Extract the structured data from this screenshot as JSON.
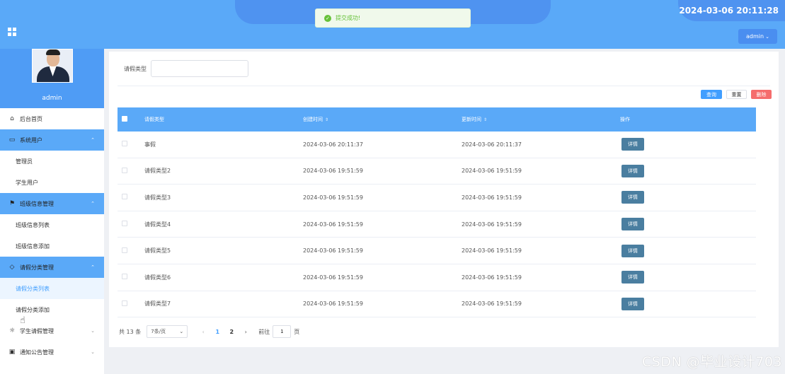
{
  "header": {
    "datetime": "2024-03-06 20:11:28",
    "user_button": "admin"
  },
  "toast": {
    "message": "提交成功!",
    "icon": "check-circle-icon",
    "color": "#67c23a"
  },
  "sidebar": {
    "username": "admin",
    "menu": [
      {
        "label": "后台首页",
        "icon": "home-icon"
      },
      {
        "label": "系统用户",
        "icon": "monitor-icon",
        "expanded": true,
        "children": [
          "管理员",
          "学生用户"
        ]
      },
      {
        "label": "班级信息管理",
        "icon": "bookmark-icon",
        "expanded": true,
        "children": [
          "班级信息列表",
          "班级信息添加"
        ]
      },
      {
        "label": "请假分类管理",
        "icon": "tag-icon",
        "expanded": true,
        "children": [
          "请假分类列表",
          "请假分类添加"
        ]
      },
      {
        "label": "学生请假管理",
        "icon": "sun-icon",
        "expanded": false
      },
      {
        "label": "通知公告管理",
        "icon": "inbox-icon",
        "expanded": false
      }
    ]
  },
  "search": {
    "label": "请假类型",
    "value": "",
    "placeholder": ""
  },
  "actions": {
    "query": "查询",
    "reset": "重置",
    "delete": "删除"
  },
  "table": {
    "headers": {
      "type": "请假类型",
      "created": "创建时间",
      "updated": "更新时间",
      "op": "操作"
    },
    "detail_label": "详情",
    "rows": [
      {
        "type": "事假",
        "created": "2024-03-06 20:11:37",
        "updated": "2024-03-06 20:11:37"
      },
      {
        "type": "请假类型2",
        "created": "2024-03-06 19:51:59",
        "updated": "2024-03-06 19:51:59"
      },
      {
        "type": "请假类型3",
        "created": "2024-03-06 19:51:59",
        "updated": "2024-03-06 19:51:59"
      },
      {
        "type": "请假类型4",
        "created": "2024-03-06 19:51:59",
        "updated": "2024-03-06 19:51:59"
      },
      {
        "type": "请假类型5",
        "created": "2024-03-06 19:51:59",
        "updated": "2024-03-06 19:51:59"
      },
      {
        "type": "请假类型6",
        "created": "2024-03-06 19:51:59",
        "updated": "2024-03-06 19:51:59"
      },
      {
        "type": "请假类型7",
        "created": "2024-03-06 19:51:59",
        "updated": "2024-03-06 19:51:59"
      }
    ]
  },
  "pagination": {
    "total_text": "共 13 条",
    "page_size": "7条/页",
    "pages": [
      "1",
      "2"
    ],
    "current_page": "1",
    "goto_prefix": "前往",
    "goto_value": "1",
    "goto_suffix": "页"
  },
  "watermark": "CSDN @毕业设计703",
  "colors": {
    "header": "#5aa9f8",
    "accent": "#409eff",
    "danger": "#f56c6c",
    "detail_button": "#4a7ea0"
  }
}
